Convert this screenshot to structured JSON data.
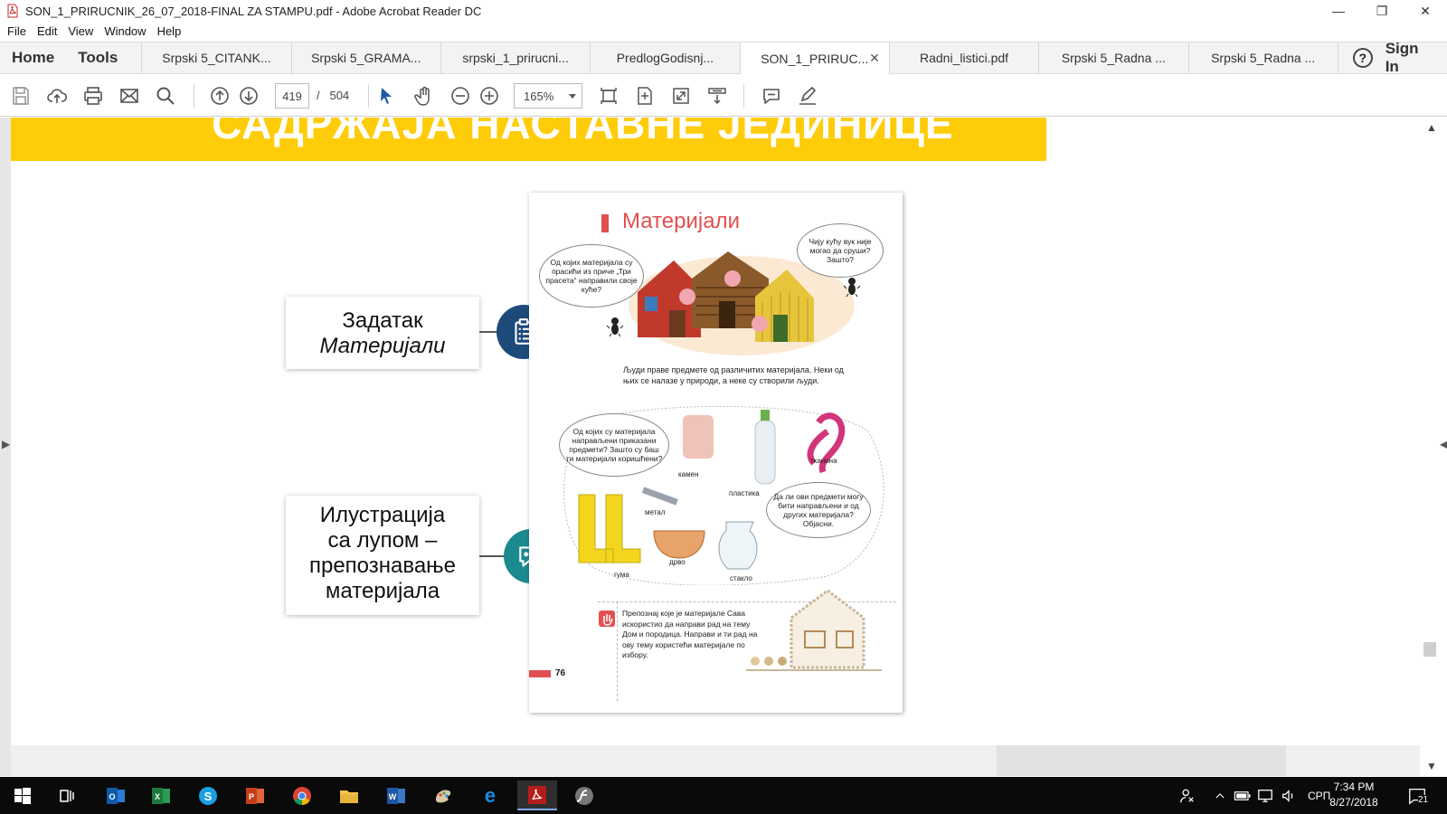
{
  "window": {
    "title": "SON_1_PRIRUCNIK_26_07_2018-FINAL ZA STAMPU.pdf - Adobe Acrobat Reader DC",
    "controls": {
      "minimize": "—",
      "restore": "❐",
      "close": "✕"
    }
  },
  "menu": [
    "File",
    "Edit",
    "View",
    "Window",
    "Help"
  ],
  "tabs": {
    "home": "Home",
    "tools": "Tools",
    "documents": [
      {
        "label": "Srpski 5_CITANK...",
        "active": false
      },
      {
        "label": "Srpski 5_GRAMA...",
        "active": false
      },
      {
        "label": "srpski_1_prirucni...",
        "active": false
      },
      {
        "label": "PredlogGodisnj...",
        "active": false
      },
      {
        "label": "SON_1_PRIRUC...",
        "active": true
      },
      {
        "label": "Radni_listici.pdf",
        "active": false
      },
      {
        "label": "Srpski 5_Radna ...",
        "active": false
      },
      {
        "label": "Srpski 5_Radna ...",
        "active": false
      }
    ],
    "close_glyph": "✕",
    "help": "?",
    "sign_in": "Sign In"
  },
  "toolbar": {
    "current_page": "419",
    "page_separator": "/",
    "total_pages": "504",
    "zoom": "165%"
  },
  "document": {
    "banner_text": "САДРЖАЈА НАСТАВНЕ ЈЕДИНИЦЕ",
    "label_task_line1": "Задатак",
    "label_task_line2": "Материјали",
    "label_illustration_lines": [
      "Илустрација",
      "са лупом –",
      "препознавање",
      "материјала"
    ],
    "page": {
      "heading": "Материјали",
      "bubble_1": "Од којих материјала су прасићи из приче „Три прасета“ направили своје куће?",
      "bubble_2": "Чију кућу вук није могао да сруши? Зашто?",
      "text_1": "Људи праве предмете од различитих материјала. Неки од њих се налазе у природи, а неке су створили људи.",
      "bubble_3": "Од којих су материјала направљени приказани предмети? Зашто су баш ти материјали коришћени?",
      "bubble_4": "Да ли ови предмети могу бити направљени и од других материјала? Објасни.",
      "captions": {
        "stone": "камен",
        "plastic": "пластика",
        "fabric": "тканина",
        "metal": "метал",
        "rubber": "гума",
        "wood": "дрво",
        "glass": "стакло"
      },
      "task_text": "Препознај које је материјале Сава искористио да направи рад на тему Дом и породица. Направи и ти рад на ову тему користећи материјале по избору.",
      "page_number": "76"
    }
  },
  "taskbar": {
    "language": "СРП",
    "time": "7:34 PM",
    "date": "8/27/2018",
    "notifications": "21"
  },
  "colors": {
    "banner": "#ffcc0a",
    "heading_red": "#e05050",
    "task_icon_bg": "#1d4a7a",
    "chat_icon_bg": "#1b8a8f",
    "taskbar": "#0a0a0a"
  }
}
